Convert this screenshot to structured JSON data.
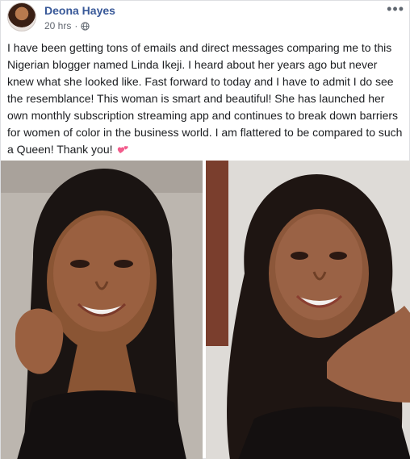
{
  "post": {
    "author": "Deona Hayes",
    "timestamp": "20 hrs",
    "visibility_dot": "·",
    "more_menu": "•••",
    "body": "I have been getting tons of emails and direct messages comparing me to this Nigerian blogger named Linda Ikeji. I heard about her years ago but never knew what she looked like. Fast forward to today and I have to admit I do see the resemblance! This woman is smart and beautiful! She has launched her own monthly subscription streaming app and continues to break down barriers for women of color in the business world. I am flattered to be compared to such a Queen! Thank you!",
    "emoji": "two-hearts-icon"
  },
  "colors": {
    "author_link": "#385898",
    "meta_text": "#616770",
    "body_text": "#1c1e21",
    "heart": "#f25c8c"
  }
}
